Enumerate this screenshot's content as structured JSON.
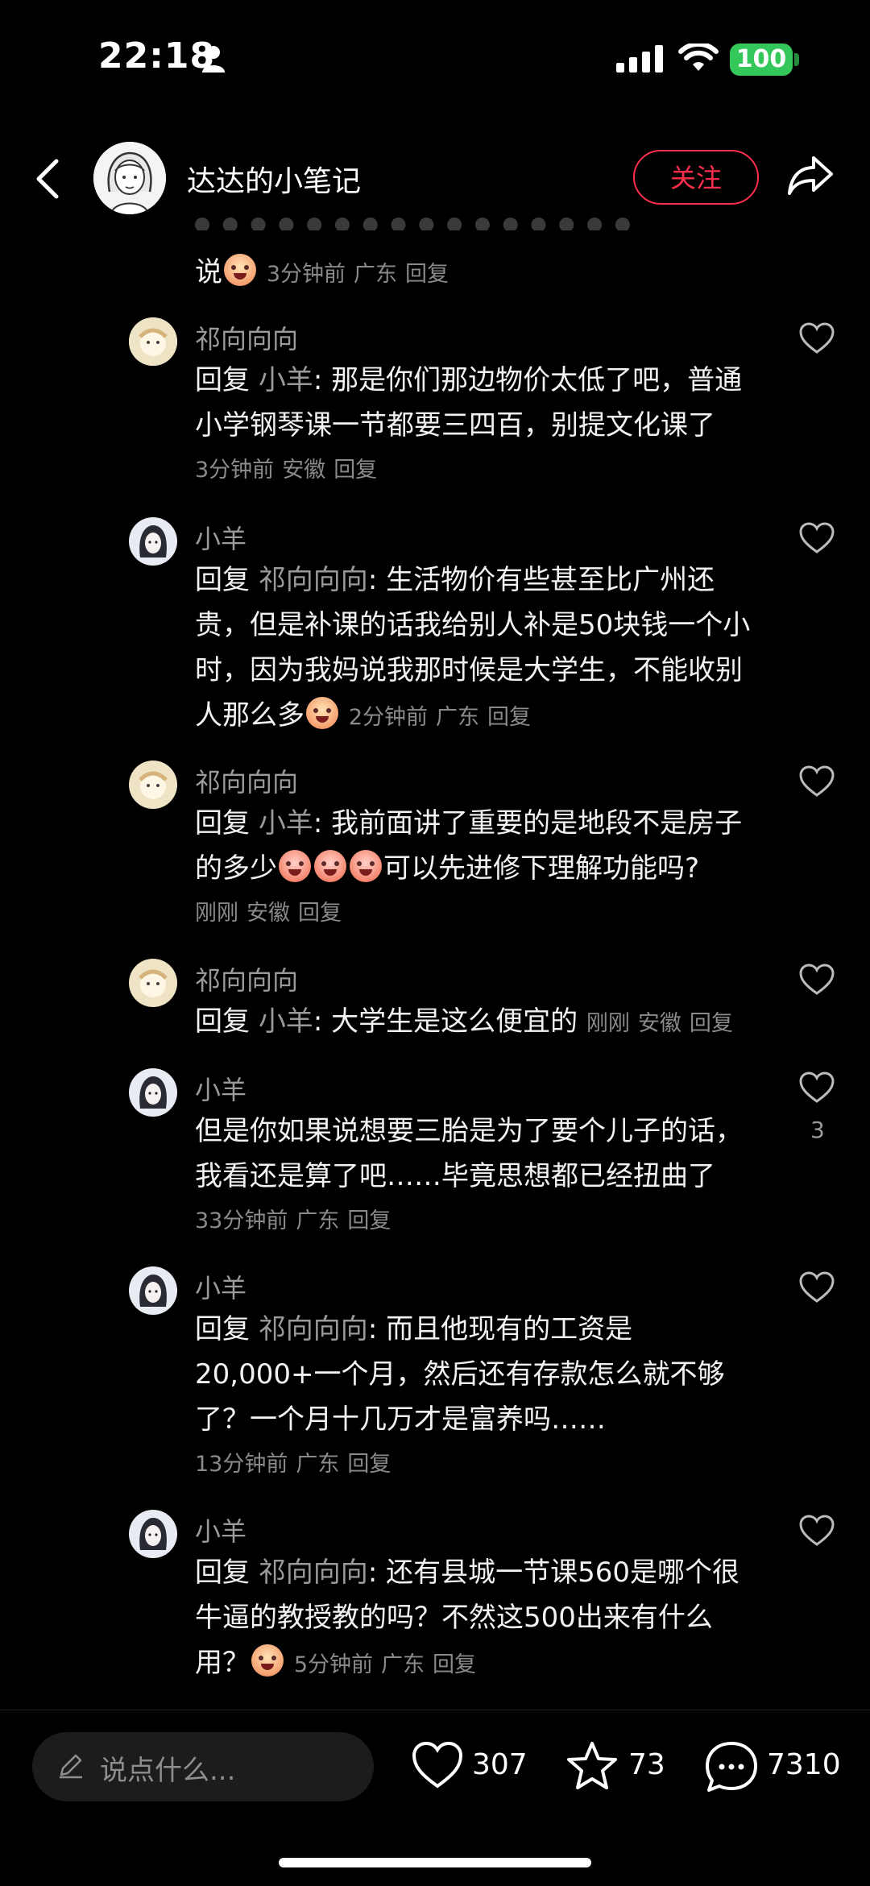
{
  "status_bar": {
    "time": "22:18",
    "battery": "100"
  },
  "header": {
    "title": "达达的小笔记",
    "follow_label": "关注"
  },
  "partial_comment": {
    "text": "说",
    "time": "3分钟前",
    "location": "广东",
    "reply": "回复"
  },
  "comments": [
    {
      "name": "祁向向向",
      "prefix": "回复",
      "mention": "小羊",
      "text": ": 那是你们那边物价太低了吧，普通小学钢琴课一节都要三四百，别提文化课了",
      "time": "3分钟前",
      "location": "安徽",
      "reply": "回复"
    },
    {
      "name": "小羊",
      "prefix": "回复",
      "mention": "祁向向向",
      "text": ": 生活物价有些甚至比广州还贵，但是补课的话我给别人补是50块钱一个小时，因为我妈说我那时候是大学生，不能收别人那么多",
      "time": "2分钟前",
      "location": "广东",
      "reply": "回复"
    },
    {
      "name": "祁向向向",
      "prefix": "回复",
      "mention": "小羊",
      "text": ": 我前面讲了重要的是地段不是房子的多少",
      "text2": "可以先进修下理解功能吗?",
      "time": "刚刚",
      "location": "安徽",
      "reply": "回复"
    },
    {
      "name": "祁向向向",
      "prefix": "回复",
      "mention": "小羊",
      "text": ": 大学生是这么便宜的",
      "time": "刚刚",
      "location": "安徽",
      "reply": "回复"
    },
    {
      "name": "小羊",
      "text": "但是你如果说想要三胎是为了要个儿子的话，我看还是算了吧……毕竟思想都已经扭曲了",
      "time": "33分钟前",
      "location": "广东",
      "reply": "回复",
      "likes": "3"
    },
    {
      "name": "小羊",
      "prefix": "回复",
      "mention": "祁向向向",
      "text": ": 而且他现有的工资是 20,000+一个月，然后还有存款怎么就不够了？一个月十几万才是富养吗……",
      "time": "13分钟前",
      "location": "广东",
      "reply": "回复"
    },
    {
      "name": "小羊",
      "prefix": "回复",
      "mention": "祁向向向",
      "text": ": 还有县城一节课560是哪个很牛逼的教授教的吗？不然这500出来有什么用？",
      "time": "5分钟前",
      "location": "广东",
      "reply": "回复"
    }
  ],
  "bottom_bar": {
    "input_placeholder": "说点什么...",
    "likes": "307",
    "stars": "73",
    "comments": "7310"
  },
  "colors": {
    "accent": "#ff2e4d",
    "background": "#000000",
    "battery": "#34c759"
  }
}
